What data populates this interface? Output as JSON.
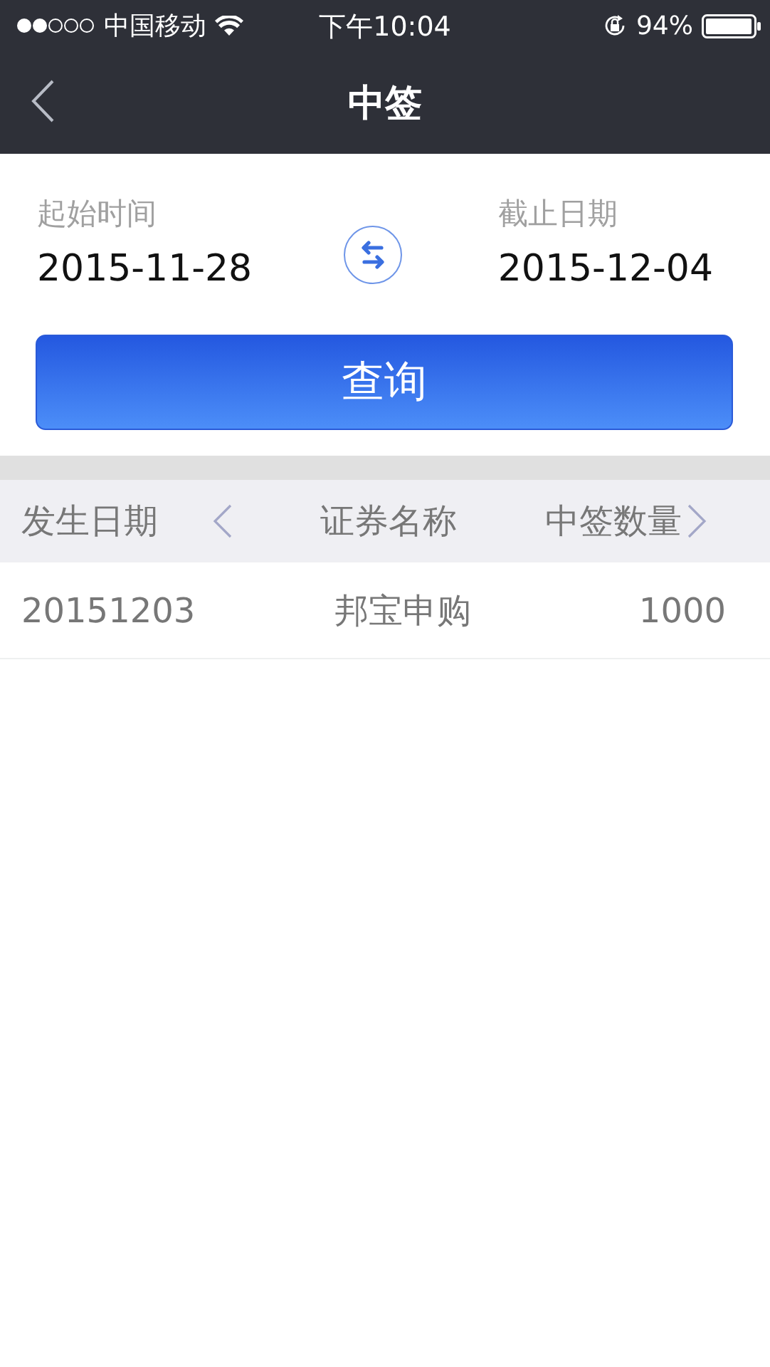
{
  "status_bar": {
    "carrier": "中国移动",
    "time": "下午10:04",
    "battery": "94%"
  },
  "nav": {
    "title": "中签"
  },
  "date_range": {
    "start": {
      "label": "起始时间",
      "value": "2015-11-28"
    },
    "end": {
      "label": "截止日期",
      "value": "2015-12-04"
    }
  },
  "query_button": "查询",
  "table": {
    "columns": [
      "发生日期",
      "证券名称",
      "中签数量"
    ],
    "rows": [
      [
        "20151203",
        "邦宝申购",
        "1000"
      ]
    ]
  }
}
